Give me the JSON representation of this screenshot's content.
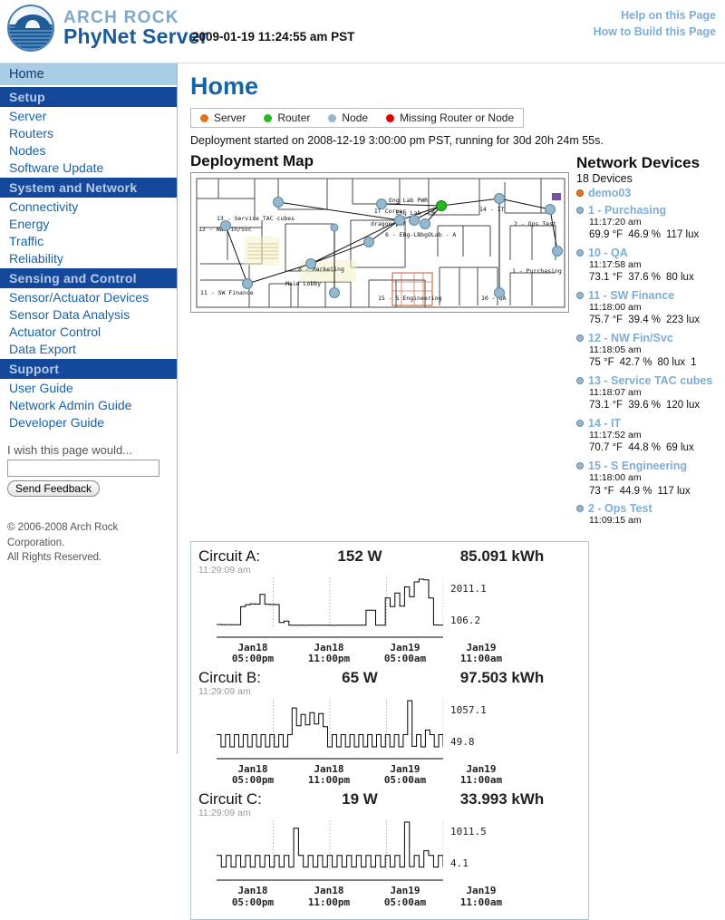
{
  "header": {
    "brand_top": "ARCH ROCK",
    "brand_bottom": "PhyNet Server",
    "clock": "2009-01-19 11:24:55 am PST",
    "help_link": "Help on this Page",
    "build_link": "How to Build this Page"
  },
  "sidebar": {
    "home": "Home",
    "sections": [
      {
        "title": "Setup",
        "items": [
          "Server",
          "Routers",
          "Nodes",
          "Software Update"
        ]
      },
      {
        "title": "System and Network",
        "items": [
          "Connectivity",
          "Energy",
          "Traffic",
          "Reliability"
        ]
      },
      {
        "title": "Sensing and Control",
        "items": [
          "Sensor/Actuator Devices",
          "Sensor Data Analysis",
          "Actuator Control",
          "Data Export"
        ]
      },
      {
        "title": "Support",
        "items": [
          "User Guide",
          "Network Admin Guide",
          "Developer Guide"
        ]
      }
    ],
    "feedback_label": "I wish this page would...",
    "feedback_value": "",
    "feedback_placeholder": "",
    "feedback_button": "Send Feedback",
    "copyright_line1": "© 2006-2008 Arch Rock Corporation.",
    "copyright_line2": "All Rights Reserved."
  },
  "main": {
    "title": "Home",
    "legend": [
      {
        "label": "Server",
        "color": "#e8721c"
      },
      {
        "label": "Router",
        "color": "#22bb22"
      },
      {
        "label": "Node",
        "color": "#93b8cf"
      },
      {
        "label": "Missing Router or Node",
        "color": "#e00000"
      }
    ],
    "deployment_status": "Deployment started on 2008-12-19 3:00:00 pm PST, running for 30d 20h 24m 55s.",
    "map_title": "Deployment Map",
    "map_labels": [
      "13 - Service TAC cubes",
      "12 - NW Fin/Svc",
      "11 - SW Finance",
      "8 - Marketing",
      "Main Lobby",
      "Eng Lab PWR",
      "IT Corner",
      "Eng Lab - B",
      "dragon-pwr",
      "6 - EBg-LBbgOLab - A",
      "14 - IT",
      "2 - Ops Test",
      "1 - Purchasing",
      "15 - S Engineering",
      "10 - QA"
    ]
  },
  "devices": {
    "title": "Network Devices",
    "count_label": "18 Devices",
    "list": [
      {
        "name": "demo03",
        "color": "#e8721c",
        "time": "",
        "temp": "",
        "humidity": "",
        "light": "",
        "extra": ""
      },
      {
        "name": "1 - Purchasing",
        "color": "#93b8cf",
        "time": "11:17:20 am",
        "temp": "69.9 °F",
        "humidity": "46.9 %",
        "light": "117 lux",
        "extra": ""
      },
      {
        "name": "10 - QA",
        "color": "#93b8cf",
        "time": "11:17:58 am",
        "temp": "73.1 °F",
        "humidity": "37.6 %",
        "light": "80 lux",
        "extra": ""
      },
      {
        "name": "11 - SW Finance",
        "color": "#93b8cf",
        "time": "11:18:00 am",
        "temp": "75.7 °F",
        "humidity": "39.4 %",
        "light": "223 lux",
        "extra": ""
      },
      {
        "name": "12 - NW Fin/Svc",
        "color": "#93b8cf",
        "time": "11:18:05 am",
        "temp": "75 °F",
        "humidity": "42.7 %",
        "light": "80 lux",
        "extra": "1"
      },
      {
        "name": "13 - Service TAC cubes",
        "color": "#93b8cf",
        "time": "11:18:07 am",
        "temp": "73.1 °F",
        "humidity": "39.6 %",
        "light": "120 lux",
        "extra": ""
      },
      {
        "name": "14 - IT",
        "color": "#93b8cf",
        "time": "11:17:52 am",
        "temp": "70.7 °F",
        "humidity": "44.8 %",
        "light": "69 lux",
        "extra": ""
      },
      {
        "name": "15 - S Engineering",
        "color": "#93b8cf",
        "time": "11:18:00 am",
        "temp": "73 °F",
        "humidity": "44.9 %",
        "light": "117 lux",
        "extra": ""
      },
      {
        "name": "2 - Ops Test",
        "color": "#93b8cf",
        "time": "11:09:15 am",
        "temp": "",
        "humidity": "",
        "light": "",
        "extra": ""
      }
    ]
  },
  "circuits": [
    {
      "name": "Circuit A:",
      "power": "152 W",
      "energy": "85.091 kWh",
      "time": "11:29:09 am",
      "y_max": "2011.1",
      "y_min": "106.2"
    },
    {
      "name": "Circuit B:",
      "power": "65 W",
      "energy": "97.503 kWh",
      "time": "11:29:09 am",
      "y_max": "1057.1",
      "y_min": "49.8"
    },
    {
      "name": "Circuit C:",
      "power": "19 W",
      "energy": "33.993 kWh",
      "time": "11:29:09 am",
      "y_max": "1011.5",
      "y_min": "4.1"
    }
  ],
  "x_axis": [
    {
      "day": "Jan18",
      "time": "05:00pm"
    },
    {
      "day": "Jan18",
      "time": "11:00pm"
    },
    {
      "day": "Jan19",
      "time": "05:00am"
    },
    {
      "day": "Jan19",
      "time": "11:00am"
    }
  ],
  "chart_data": [
    {
      "type": "line",
      "title": "Circuit A",
      "ylabel": "W",
      "ylim": [
        106.2,
        2011.1
      ],
      "x": [
        "Jan18 05:00pm",
        "Jan18 11:00pm",
        "Jan19 05:00am",
        "Jan19 11:00am"
      ],
      "values": [
        180,
        170,
        175,
        168,
        172,
        900,
        980,
        1010,
        1005,
        1400,
        1000,
        990,
        985,
        260,
        320,
        150,
        145,
        150,
        148,
        152,
        150,
        149,
        151,
        150,
        148,
        150,
        152,
        149,
        151,
        150,
        150,
        760,
        755,
        150,
        152,
        1250,
        900,
        1450,
        920,
        1700,
        1300,
        1900,
        2011,
        1980,
        1250,
        160,
        158,
        157
      ]
    },
    {
      "type": "line",
      "title": "Circuit B",
      "ylabel": "W",
      "ylim": [
        49.8,
        1057.1
      ],
      "x": [
        "Jan18 05:00pm",
        "Jan18 11:00pm",
        "Jan19 05:00am",
        "Jan19 11:00am"
      ],
      "values": [
        330,
        70,
        330,
        70,
        330,
        70,
        330,
        70,
        330,
        70,
        330,
        70,
        330,
        70,
        330,
        70,
        330,
        900,
        520,
        760,
        540,
        800,
        560,
        780,
        500,
        70,
        330,
        70,
        330,
        70,
        330,
        70,
        330,
        70,
        330,
        70,
        330,
        70,
        330,
        70,
        330,
        70,
        330,
        1057,
        80,
        330,
        70,
        430,
        330,
        70,
        330,
        70
      ]
    },
    {
      "type": "line",
      "title": "Circuit C",
      "ylabel": "W",
      "ylim": [
        4.1,
        1011.5
      ],
      "x": [
        "Jan18 05:00pm",
        "Jan18 11:00pm",
        "Jan19 05:00am",
        "Jan19 11:00am"
      ],
      "values": [
        300,
        50,
        300,
        50,
        300,
        50,
        300,
        50,
        300,
        50,
        300,
        50,
        300,
        50,
        300,
        50,
        880,
        300,
        50,
        300,
        50,
        300,
        50,
        300,
        50,
        300,
        50,
        300,
        50,
        300,
        50,
        300,
        50,
        300,
        50,
        300,
        50,
        300,
        50,
        1011,
        60,
        300,
        50,
        400,
        300,
        50,
        300,
        50
      ]
    }
  ]
}
